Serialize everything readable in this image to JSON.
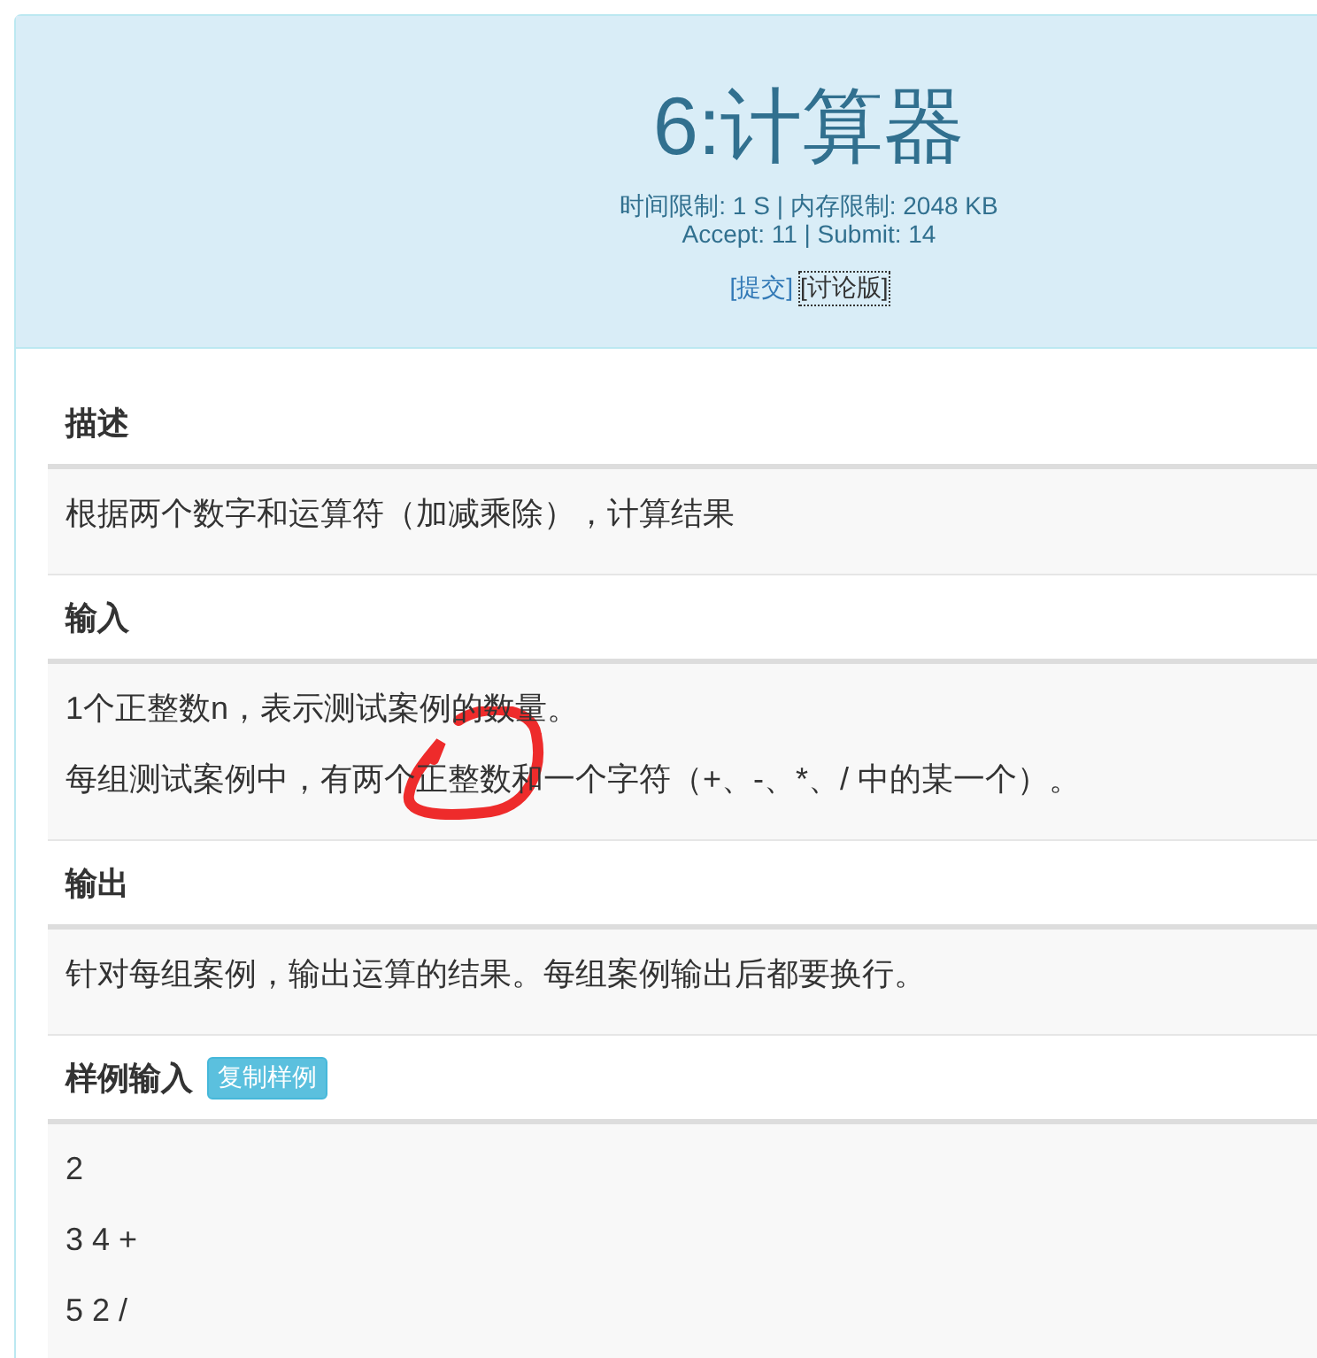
{
  "header": {
    "title": "6:计算器",
    "limits": "时间限制: 1 S | 内存限制: 2048 KB",
    "stats": "Accept: 11 | Submit: 14",
    "links": [
      {
        "label": "[提交]",
        "focused": false
      },
      {
        "label": "[讨论版]",
        "focused": true
      }
    ]
  },
  "sections": [
    {
      "title": "描述",
      "lines": [
        "根据两个数字和运算符（加减乘除），计算结果"
      ]
    },
    {
      "title": "输入",
      "lines": [
        "1个正整数n，表示测试案例的数量。",
        "每组测试案例中，有两个正整数和一个字符（+、-、*、/ 中的某一个）。"
      ],
      "annotated": true
    },
    {
      "title": "输出",
      "lines": [
        "针对每组案例，输出运算的结果。每组案例输出后都要换行。"
      ]
    },
    {
      "title": "样例输入",
      "button": "复制样例",
      "lines": [
        "2",
        "3 4 +",
        "5 2 /"
      ]
    }
  ]
}
